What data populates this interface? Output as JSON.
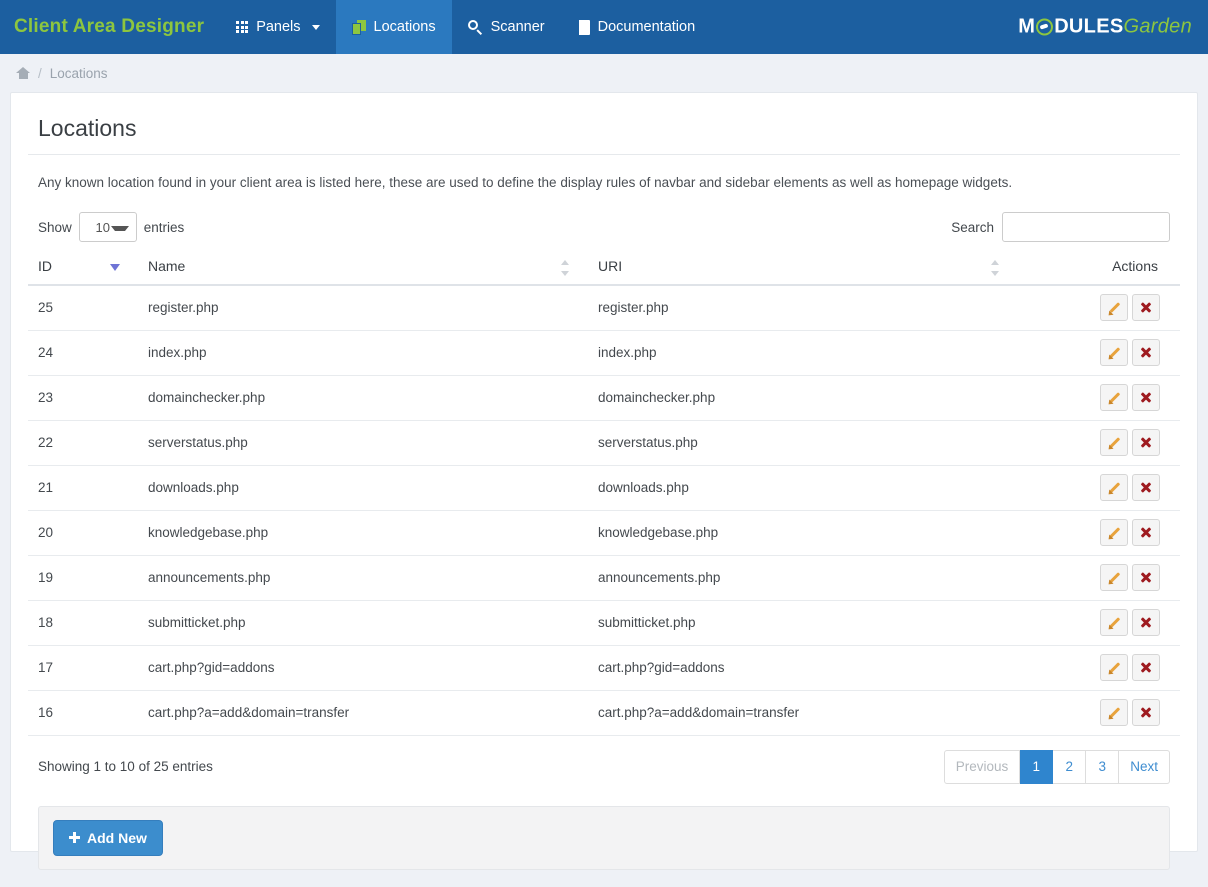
{
  "navbar": {
    "brand": "Client Area Designer",
    "items": [
      {
        "label": "Panels",
        "icon": "grid-icon",
        "has_caret": true,
        "active": false
      },
      {
        "label": "Locations",
        "icon": "files-icon",
        "has_caret": false,
        "active": true
      },
      {
        "label": "Scanner",
        "icon": "search-icon",
        "has_caret": false,
        "active": false
      },
      {
        "label": "Documentation",
        "icon": "book-icon",
        "has_caret": false,
        "active": false
      }
    ],
    "logo": {
      "part1": "M",
      "part2": "DULES",
      "part3": "Garden"
    },
    "colors": {
      "background": "#1c5fa0",
      "active_tab": "#2b79bf",
      "brand_green": "#8dc63f"
    }
  },
  "breadcrumb": {
    "home_icon": "home-icon",
    "separator": "/",
    "current": "Locations"
  },
  "page": {
    "title": "Locations",
    "description": "Any known location found in your client area is listed here, these are used to define the display rules of navbar and sidebar elements as well as homepage widgets."
  },
  "controls": {
    "show_label": "Show",
    "entries_label": "entries",
    "page_length": "10",
    "search_label": "Search",
    "search_value": "",
    "search_placeholder": ""
  },
  "table": {
    "columns": [
      {
        "label": "ID",
        "sort": "desc-active"
      },
      {
        "label": "Name",
        "sort": "both"
      },
      {
        "label": "URI",
        "sort": "both"
      },
      {
        "label": "Actions",
        "sort": "none"
      }
    ],
    "rows": [
      {
        "id": "25",
        "name": "register.php",
        "uri": "register.php"
      },
      {
        "id": "24",
        "name": "index.php",
        "uri": "index.php"
      },
      {
        "id": "23",
        "name": "domainchecker.php",
        "uri": "domainchecker.php"
      },
      {
        "id": "22",
        "name": "serverstatus.php",
        "uri": "serverstatus.php"
      },
      {
        "id": "21",
        "name": "downloads.php",
        "uri": "downloads.php"
      },
      {
        "id": "20",
        "name": "knowledgebase.php",
        "uri": "knowledgebase.php"
      },
      {
        "id": "19",
        "name": "announcements.php",
        "uri": "announcements.php"
      },
      {
        "id": "18",
        "name": "submitticket.php",
        "uri": "submitticket.php"
      },
      {
        "id": "17",
        "name": "cart.php?gid=addons",
        "uri": "cart.php?gid=addons"
      },
      {
        "id": "16",
        "name": "cart.php?a=add&domain=transfer",
        "uri": "cart.php?a=add&domain=transfer"
      }
    ],
    "row_actions": {
      "edit_icon": "pencil-icon",
      "delete_icon": "x-icon"
    }
  },
  "footer": {
    "showing": "Showing 1 to 10 of 25 entries",
    "pagination": [
      {
        "label": "Previous",
        "state": "disabled"
      },
      {
        "label": "1",
        "state": "active"
      },
      {
        "label": "2",
        "state": "normal"
      },
      {
        "label": "3",
        "state": "normal"
      },
      {
        "label": "Next",
        "state": "normal"
      }
    ]
  },
  "panel_footer": {
    "add_new_label": "Add New",
    "add_icon": "plus-icon"
  }
}
